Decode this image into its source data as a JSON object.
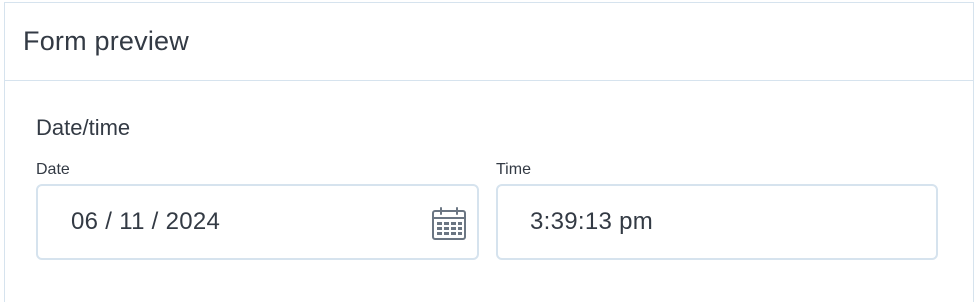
{
  "panel": {
    "title": "Form preview"
  },
  "section": {
    "label": "Date/time"
  },
  "date_field": {
    "label": "Date",
    "value": "06 / 11 / 2024",
    "icon": "calendar-icon"
  },
  "time_field": {
    "label": "Time",
    "value": "3:39:13 pm"
  },
  "colors": {
    "border": "#d6e3ee",
    "text": "#333a44",
    "icon": "#6b7683"
  }
}
